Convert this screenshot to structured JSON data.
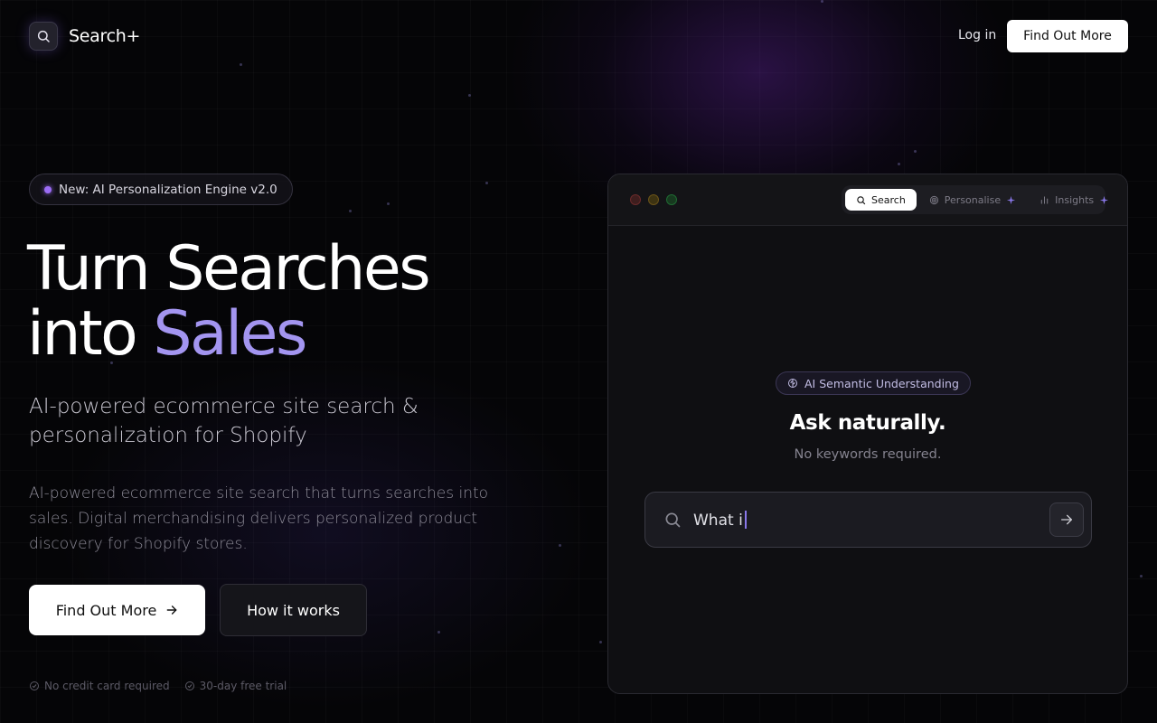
{
  "header": {
    "brand": "Search+",
    "login_label": "Log in",
    "cta_label": "Find Out More"
  },
  "hero": {
    "badge": "New: AI Personalization Engine v2.0",
    "title_line1": "Turn Searches",
    "title_line2_plain": "into ",
    "title_line2_accent": "Sales",
    "subtitle": "AI-powered ecommerce site search & personalization for Shopify",
    "description": "AI-powered ecommerce site search that turns searches into sales. Digital merchandising delivers personalized product discovery for Shopify stores.",
    "primary_button": "Find Out More",
    "secondary_button": "How it works",
    "perks": [
      "No credit card required",
      "30-day free trial"
    ]
  },
  "demo": {
    "tabs": [
      {
        "label": "Search",
        "icon": "search-icon",
        "active": true
      },
      {
        "label": "Personalise",
        "icon": "target-icon",
        "active": false
      },
      {
        "label": "Insights",
        "icon": "bar-chart-icon",
        "active": false
      }
    ],
    "ai_badge": "AI Semantic Understanding",
    "heading": "Ask naturally.",
    "subheading": "No keywords required.",
    "search_value": "What i"
  },
  "colors": {
    "accent": "#a395f0",
    "badge_dot": "#9b6cf4",
    "background": "#050507"
  }
}
